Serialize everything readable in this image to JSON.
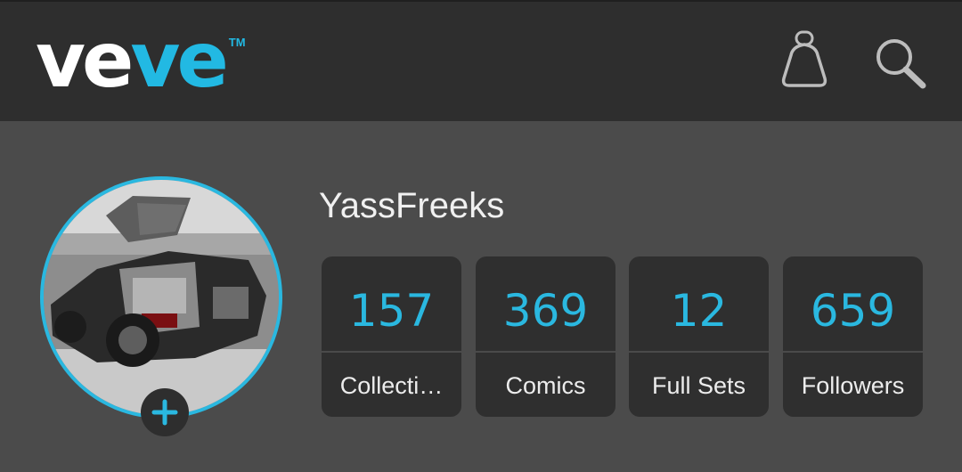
{
  "header": {
    "logo": {
      "main": "ve",
      "accent": "ve",
      "tm": "TM"
    },
    "icons": {
      "bag": "shopping-bag-icon",
      "search": "search-icon"
    }
  },
  "profile": {
    "username": "YassFreeks",
    "avatar_icon": "delorean-car-avatar",
    "add_icon": "plus-icon",
    "accent_color": "#2ab8e0"
  },
  "stats": [
    {
      "value": "157",
      "label": "Collecti…"
    },
    {
      "value": "369",
      "label": "Comics"
    },
    {
      "value": "12",
      "label": "Full Sets"
    },
    {
      "value": "659",
      "label": "Followers"
    }
  ]
}
